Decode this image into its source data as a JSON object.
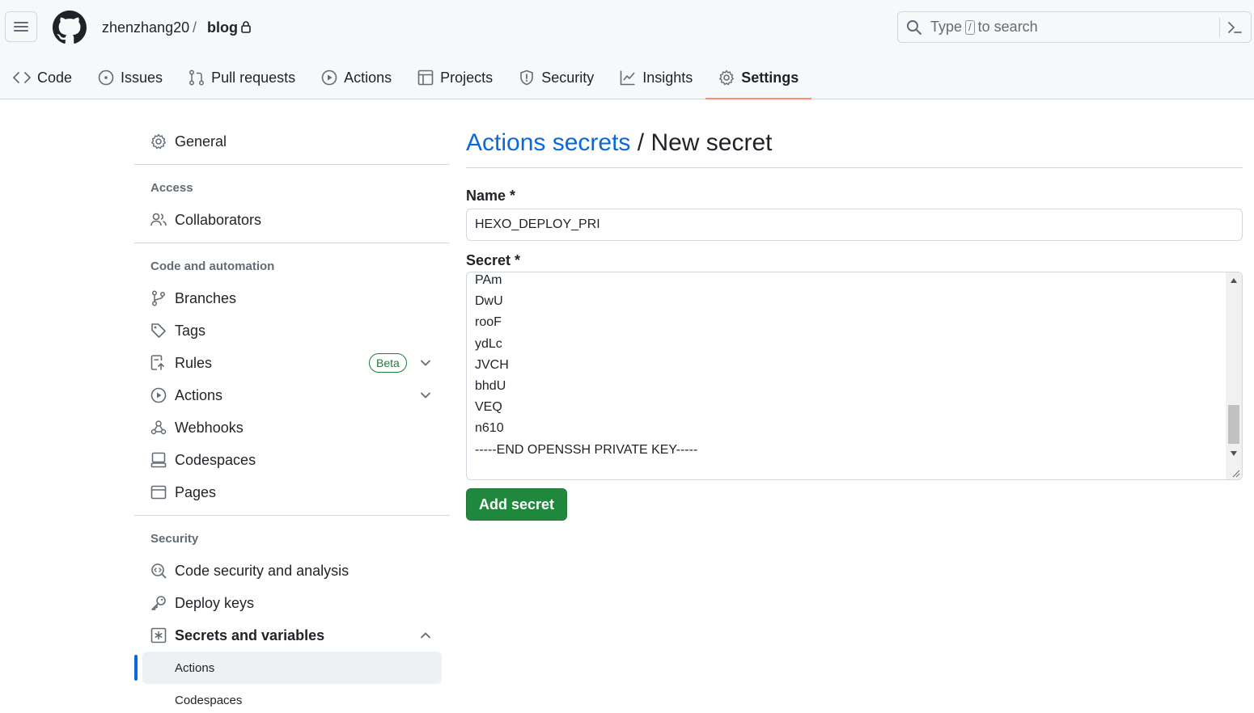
{
  "header": {
    "owner": "zhenzhang20",
    "separator": "/",
    "repo": "blog",
    "search": {
      "prefix": "Type",
      "key": "/",
      "suffix": "to search"
    }
  },
  "tabs": [
    {
      "label": "Code",
      "icon": "code-icon"
    },
    {
      "label": "Issues",
      "icon": "issue-icon"
    },
    {
      "label": "Pull requests",
      "icon": "pull-request-icon"
    },
    {
      "label": "Actions",
      "icon": "play-icon"
    },
    {
      "label": "Projects",
      "icon": "table-icon"
    },
    {
      "label": "Security",
      "icon": "shield-icon"
    },
    {
      "label": "Insights",
      "icon": "graph-icon"
    },
    {
      "label": "Settings",
      "icon": "gear-icon",
      "active": true
    }
  ],
  "sidebar": {
    "general": "General",
    "access_heading": "Access",
    "collaborators": "Collaborators",
    "code_heading": "Code and automation",
    "branches": "Branches",
    "tags": "Tags",
    "rules": "Rules",
    "rules_badge": "Beta",
    "actions": "Actions",
    "webhooks": "Webhooks",
    "codespaces": "Codespaces",
    "pages": "Pages",
    "security_heading": "Security",
    "code_security": "Code security and analysis",
    "deploy_keys": "Deploy keys",
    "secrets_variables": "Secrets and variables",
    "sub_actions": "Actions",
    "sub_codespaces": "Codespaces"
  },
  "main": {
    "title_link": "Actions secrets",
    "title_sep": "/",
    "title_rest": "New secret",
    "name_label": "Name *",
    "name_value": "HEXO_DEPLOY_PRI",
    "secret_label": "Secret *",
    "secret_lines": [
      "PAm",
      "DwU",
      "rooF",
      "ydLc",
      "JVCH",
      "bhdU",
      "VEQ",
      "n610",
      "-----END OPENSSH PRIVATE KEY-----"
    ],
    "add_button": "Add secret"
  },
  "colors": {
    "accent_link": "#0969da",
    "button_green": "#1f883d",
    "tab_underline": "#fd8c73",
    "beta_green": "#1a7f37"
  }
}
